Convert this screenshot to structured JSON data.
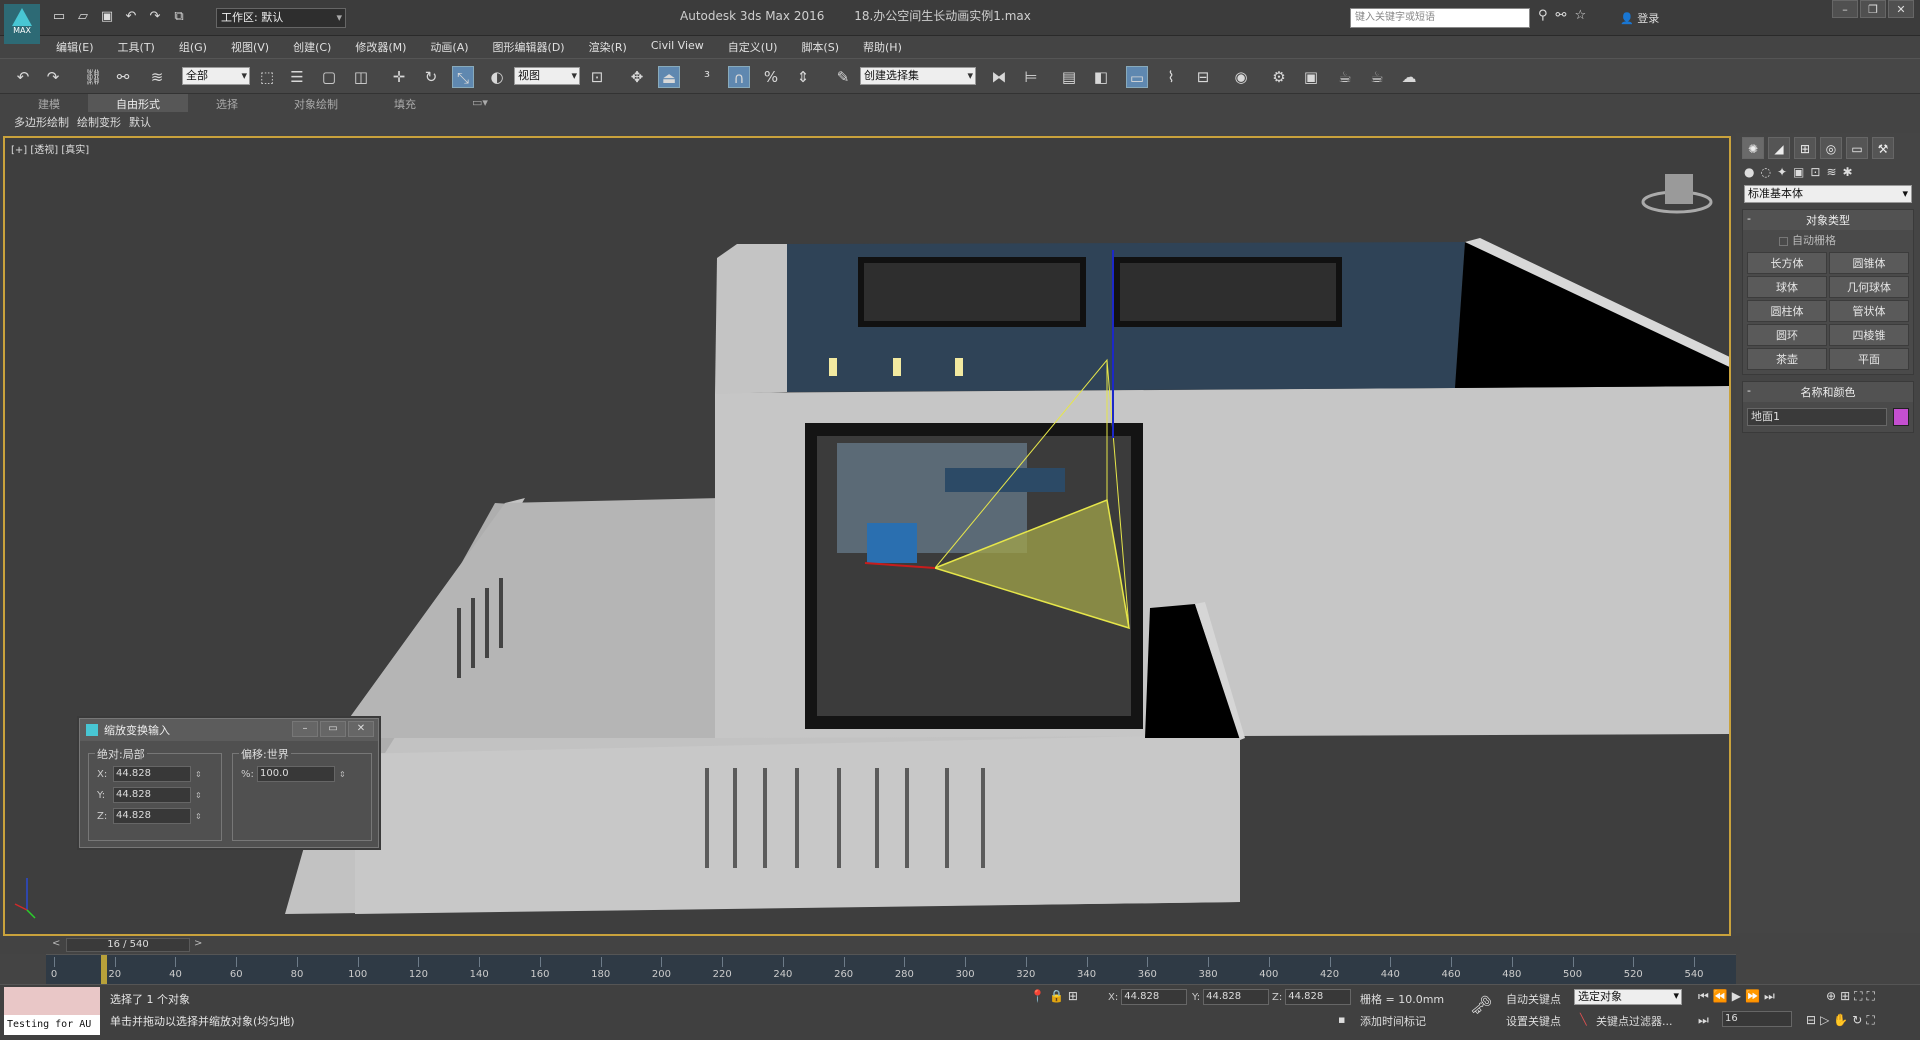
{
  "titlebar": {
    "app_name": "Autodesk 3ds Max 2016",
    "file_name": "18.办公空间生长动画实例1.max",
    "workspace": "工作区: 默认",
    "search_placeholder": "键入关键字或短语",
    "login": "登录",
    "logo_text": "MAX"
  },
  "menu": [
    "编辑(E)",
    "工具(T)",
    "组(G)",
    "视图(V)",
    "创建(C)",
    "修改器(M)",
    "动画(A)",
    "图形编辑器(D)",
    "渲染(R)",
    "Civil View",
    "自定义(U)",
    "脚本(S)",
    "帮助(H)"
  ],
  "toolbar": {
    "selection_filter": "全部",
    "ref_coord": "视图",
    "named_selection": "创建选择集"
  },
  "ribbon": {
    "tabs": [
      "建模",
      "自由形式",
      "选择",
      "对象绘制",
      "填充"
    ],
    "active_tab": "自由形式",
    "sub_items": [
      "多边形绘制",
      "绘制变形",
      "默认"
    ]
  },
  "viewport": {
    "label": "[+] [透视] [真实]",
    "border_color": "#c9a23c"
  },
  "command_panel": {
    "category": "标准基本体",
    "object_type_title": "对象类型",
    "autogrid": "自动栅格",
    "primitives": [
      "长方体",
      "圆锥体",
      "球体",
      "几何球体",
      "圆柱体",
      "管状体",
      "圆环",
      "四棱锥",
      "茶壶",
      "平面"
    ],
    "name_color_title": "名称和颜色",
    "object_name": "地面1",
    "object_color": "#c44fd0"
  },
  "scale_dialog": {
    "title": "缩放变换输入",
    "abs_group": "绝对:局部",
    "offset_group": "偏移:世界",
    "x": "44.828",
    "y": "44.828",
    "z": "44.828",
    "pct_label": "%:",
    "pct": "100.0"
  },
  "timeline": {
    "frame_display": "16 / 540",
    "ticks": [
      "0",
      "20",
      "40",
      "60",
      "80",
      "100",
      "120",
      "140",
      "160",
      "180",
      "200",
      "220",
      "240",
      "260",
      "280",
      "300",
      "320",
      "340",
      "360",
      "380",
      "400",
      "420",
      "440",
      "460",
      "480",
      "500",
      "520",
      "540"
    ]
  },
  "status": {
    "maxscript_text": "Testing for AU",
    "selection_info": "选择了 1 个对象",
    "prompt": "单击并拖动以选择并缩放对象(均匀地)",
    "x_label": "X:",
    "y_label": "Y:",
    "z_label": "Z:",
    "x": "44.828",
    "y": "44.828",
    "z": "44.828",
    "grid": "栅格 = 10.0mm",
    "add_time_tag": "添加时间标记",
    "auto_key": "自动关键点",
    "set_key": "设置关键点",
    "key_mode": "选定对象",
    "key_filters": "关键点过滤器...",
    "current_frame": "16"
  }
}
